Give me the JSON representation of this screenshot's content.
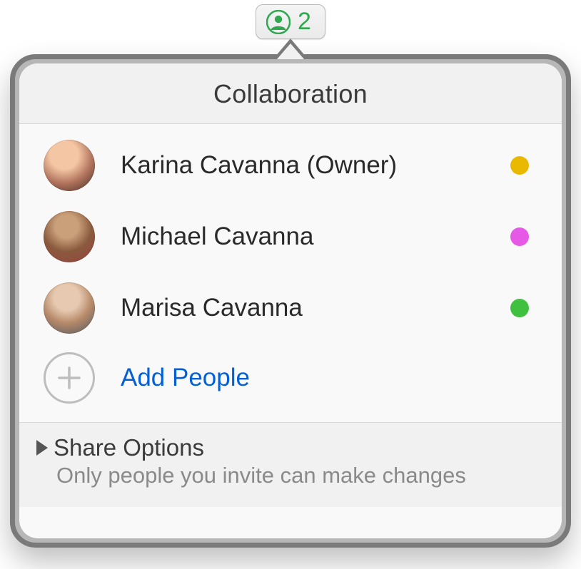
{
  "button": {
    "count": "2",
    "icon_color": "#2fa84f"
  },
  "header": {
    "title": "Collaboration"
  },
  "participants": [
    {
      "name": "Karina Cavanna (Owner)",
      "dot_color": "#e8b900"
    },
    {
      "name": "Michael Cavanna",
      "dot_color": "#e658e6"
    },
    {
      "name": "Marisa Cavanna",
      "dot_color": "#3fc13f"
    }
  ],
  "add": {
    "label": "Add People",
    "label_color": "#0560d6"
  },
  "share": {
    "title": "Share Options",
    "subtitle": "Only people you invite can make changes"
  }
}
